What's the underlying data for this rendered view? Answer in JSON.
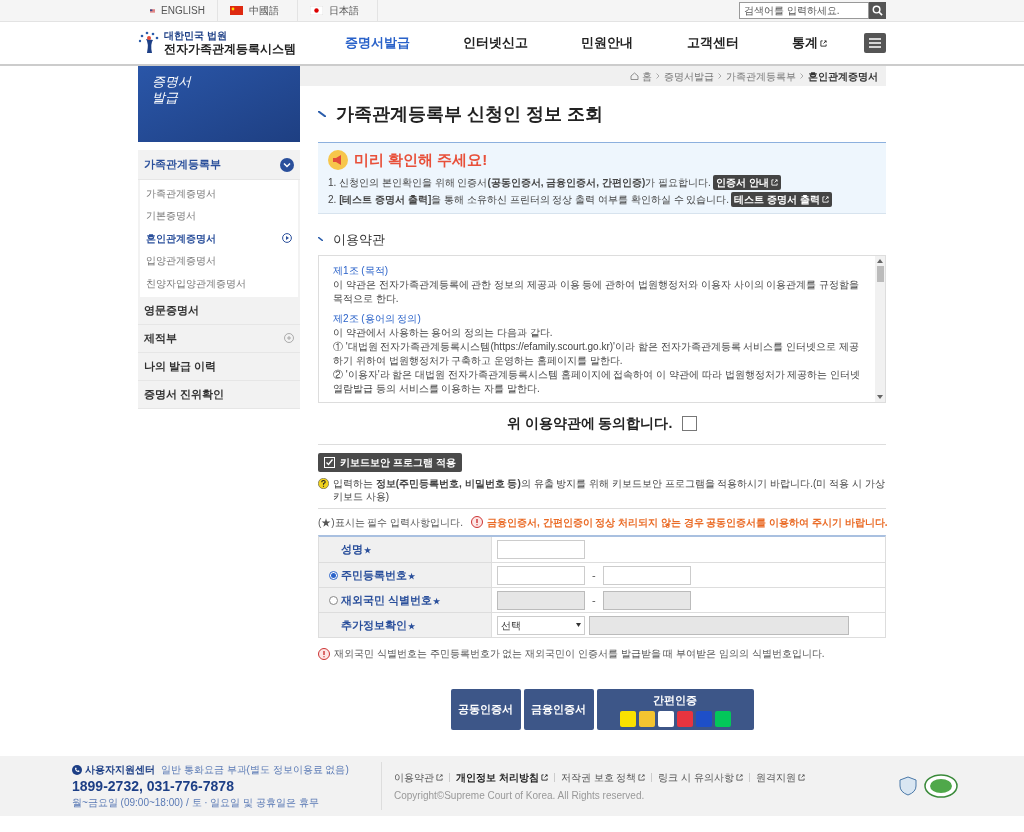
{
  "language_bar": [
    {
      "label": "ENGLISH"
    },
    {
      "label": "中國語"
    },
    {
      "label": "日本語"
    }
  ],
  "search": {
    "placeholder": "검색어를 입력하세요."
  },
  "logo": {
    "subtitle": "대한민국 법원",
    "title": "전자가족관계등록시스템"
  },
  "nav": [
    {
      "label": "증명서발급",
      "selected": true,
      "external": false
    },
    {
      "label": "인터넷신고",
      "selected": false,
      "external": false
    },
    {
      "label": "민원안내",
      "selected": false,
      "external": false
    },
    {
      "label": "고객센터",
      "selected": false,
      "external": false
    },
    {
      "label": "통계",
      "selected": false,
      "external": true
    }
  ],
  "breadcrumb": [
    "홈",
    "증명서발급",
    "가족관계등록부",
    "혼인관계증명서"
  ],
  "sidebar": {
    "banner_text": "증명서 발급",
    "items": [
      {
        "label": "가족관계등록부",
        "kind": "expandable",
        "expanded": true,
        "selected": true,
        "children": [
          {
            "label": "가족관계증명서",
            "selected": false
          },
          {
            "label": "기본증명서",
            "selected": false
          },
          {
            "label": "혼인관계증명서",
            "selected": true
          },
          {
            "label": "입양관계증명서",
            "selected": false
          },
          {
            "label": "친양자입양관계증명서",
            "selected": false
          }
        ]
      },
      {
        "label": "영문증명서",
        "kind": "plain",
        "selected": false
      },
      {
        "label": "제적부",
        "kind": "expandable",
        "expanded": false,
        "selected": false
      },
      {
        "label": "나의 발급 이력",
        "kind": "plain",
        "selected": false
      },
      {
        "label": "증명서 진위확인",
        "kind": "plain",
        "selected": false
      }
    ]
  },
  "page_title": "가족관계등록부 신청인 정보 조회",
  "notice": {
    "title": "미리 확인해 주세요!",
    "lines": [
      {
        "text": "1. 신청인의 본인확인을 위해 인증서**(공동인증서, 금융인증서, 간편인증)**가 필요합니다.",
        "button": "인증서 안내"
      },
      {
        "text": "2. **[테스트 증명서 출력]**을 통해 소유하신 프린터의 정상 출력 여부를 확인하실 수 있습니다.",
        "button": "테스트 증명서 출력"
      }
    ]
  },
  "terms": {
    "heading": "이용약관",
    "articles": [
      {
        "title": "제1조 (목적)",
        "paragraphs": [
          "이 약관은 전자가족관계등록에 관한 정보의 제공과 이용 등에 관하여 법원행정처와 이용자 사이의 이용관계를 규정함을 목적으로 한다."
        ]
      },
      {
        "title": "제2조 (용어의 정의)",
        "paragraphs": [
          "이 약관에서 사용하는 용어의 정의는 다음과 같다.",
          "① '대법원 전자가족관계등록시스템(https://efamily.scourt.go.kr)'이라 함은 전자가족관계등록 서비스를 인터넷으로 제공하기 위하여 법원행정처가 구축하고 운영하는 홈페이지를 말한다.",
          "② '이용자'라 함은 대법원 전자가족관계등록시스템 홈페이지에 접속하여 이 약관에 따라 법원행정처가 제공하는 인터넷 열람발급 등의 서비스를 이용하는 자를 말한다."
        ]
      }
    ]
  },
  "agree": {
    "label": "위 이용약관에 동의합니다.",
    "checked": false
  },
  "keyboard_security": {
    "label": "키보드보안 프로그램 적용",
    "checked": true,
    "hint": "입력하는 **정보(주민등록번호, 비밀번호 등)**의 유출 방지를 위해 키보드보안 프로그램을 적용하시기 바랍니다.(미 적용 시 가상키보드 사용)"
  },
  "required_note": "(★)표시는 필수 입력사항입니다.",
  "warning": "금융인증서, 간편인증이 정상 처리되지 않는 경우 공동인증서를 이용하여 주시기 바랍니다.",
  "form_rows": [
    {
      "label": "성명",
      "required_mark": "★",
      "kind": "text",
      "disabled": false
    },
    {
      "label": "주민등록번호",
      "required_mark": "★",
      "kind": "split",
      "radio": true,
      "selected": true,
      "disabled": false,
      "separator": "-"
    },
    {
      "label": "재외국민 식별번호",
      "required_mark": "★",
      "kind": "split",
      "radio": true,
      "selected": false,
      "disabled": true,
      "separator": "-"
    },
    {
      "label": "추가정보확인",
      "required_mark": "★",
      "kind": "select",
      "value": "선택"
    }
  ],
  "form_note": "재외국민 식별번호는 주민등록번호가 없는 재외국민이 인증서를 발급받을 때 부여받은 임의의 식별번호입니다.",
  "auth_buttons": [
    {
      "label": "공동인증서",
      "kind": "plain"
    },
    {
      "label": "금융인증서",
      "kind": "plain"
    },
    {
      "label": "간편인증",
      "kind": "providers"
    }
  ],
  "footer": {
    "support_title": "사용자지원센터",
    "support_note": "일반 통화요금 부과(별도 정보이용료 없음)",
    "phone": "1899-2732, 031-776-7878",
    "hours": "월~금요일 (09:00~18:00) / 토 · 일요일 및 공휴일은 휴무",
    "links": [
      {
        "label": "이용약관",
        "bold": false
      },
      {
        "label": "개인정보 처리방침",
        "bold": true
      },
      {
        "label": "저작권 보호 정책",
        "bold": false
      },
      {
        "label": "링크 시 유의사항",
        "bold": false
      },
      {
        "label": "원격지원",
        "bold": false
      }
    ],
    "copyright": "Copyright©Supreme Court of Korea. All Rights reserved."
  }
}
